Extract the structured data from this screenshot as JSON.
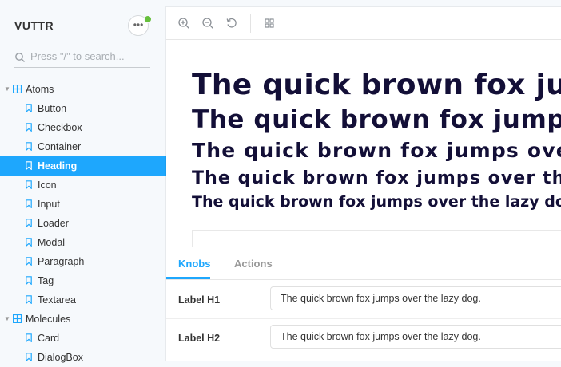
{
  "sidebar": {
    "brand": "VUTTR",
    "search_placeholder": "Press \"/\" to search...",
    "groups": [
      {
        "label": "Atoms",
        "items": [
          {
            "label": "Button"
          },
          {
            "label": "Checkbox"
          },
          {
            "label": "Container"
          },
          {
            "label": "Heading",
            "active": true
          },
          {
            "label": "Icon"
          },
          {
            "label": "Input"
          },
          {
            "label": "Loader"
          },
          {
            "label": "Modal"
          },
          {
            "label": "Paragraph"
          },
          {
            "label": "Tag"
          },
          {
            "label": "Textarea"
          }
        ]
      },
      {
        "label": "Molecules",
        "items": [
          {
            "label": "Card"
          },
          {
            "label": "DialogBox"
          }
        ]
      }
    ]
  },
  "toolbar": {
    "icons": [
      "zoom-in-icon",
      "zoom-out-icon",
      "reset-zoom-icon",
      "grid-icon"
    ]
  },
  "preview": {
    "h1": "The quick brown fox jumps over the lazy dog.",
    "h2": "The quick brown fox jumps over the lazy dog.",
    "h3": "The quick brown fox jumps over the lazy dog.",
    "h4": "The quick brown fox jumps over the lazy dog.",
    "h5": "The quick brown fox jumps over the lazy dog."
  },
  "addons": {
    "tabs": [
      {
        "label": "Knobs",
        "active": true
      },
      {
        "label": "Actions"
      }
    ],
    "knobs": [
      {
        "label": "Label H1",
        "value": "The quick brown fox jumps over the lazy dog."
      },
      {
        "label": "Label H2",
        "value": "The quick brown fox jumps over the lazy dog."
      }
    ]
  },
  "colors": {
    "accent": "#1ea7fd",
    "heading_text": "#130f37",
    "status_dot": "#66bf3c"
  }
}
